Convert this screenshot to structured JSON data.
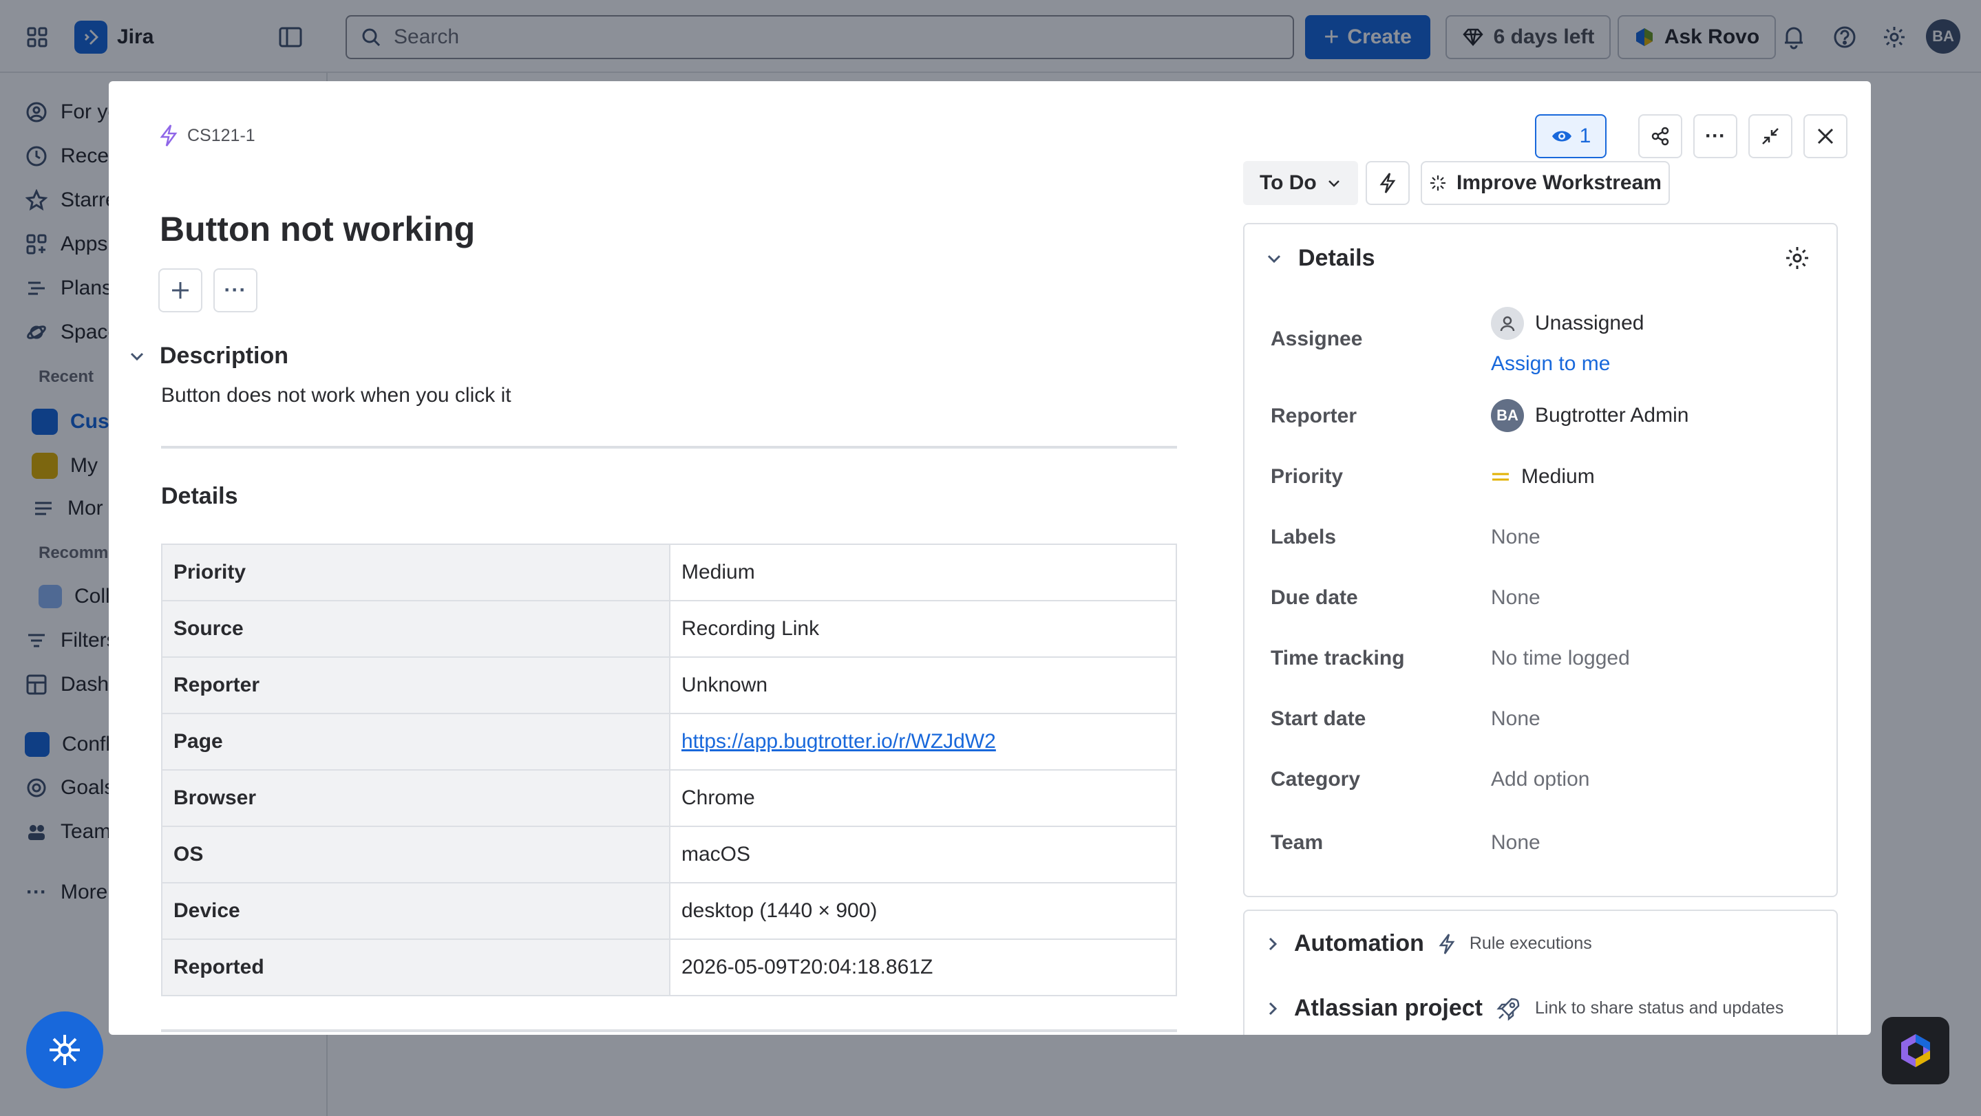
{
  "topbar": {
    "app_name": "Jira",
    "search_placeholder": "Search",
    "create_label": "Create",
    "trial_label": "6 days left",
    "ask_rovo_label": "Ask Rovo",
    "avatar_initials": "BA"
  },
  "sidebar": {
    "items": [
      {
        "label": "For yo",
        "icon": "person-circle-icon"
      },
      {
        "label": "Recen",
        "icon": "clock-icon"
      },
      {
        "label": "Starre",
        "icon": "star-icon"
      },
      {
        "label": "Apps",
        "icon": "apps-icon"
      },
      {
        "label": "Plans",
        "icon": "plans-icon"
      },
      {
        "label": "Space",
        "icon": "spaces-icon"
      }
    ],
    "recent_heading": "Recent",
    "recent_items": [
      {
        "label": "Cus"
      },
      {
        "label": "My"
      },
      {
        "label": "Mor"
      }
    ],
    "recommended_heading": "Recomm",
    "recommended_items": [
      {
        "label": "Coll"
      }
    ],
    "bottom_items": [
      {
        "label": "Filters"
      },
      {
        "label": "Dashl"
      },
      {
        "label": "Confl"
      },
      {
        "label": "Goals"
      },
      {
        "label": "Team"
      },
      {
        "label": "More"
      }
    ]
  },
  "issue": {
    "key": "CS121-1",
    "title": "Button not working",
    "description_heading": "Description",
    "description": "Button does not work when you click it",
    "details_heading": "Details",
    "details_rows": [
      {
        "key": "Priority",
        "value": "Medium"
      },
      {
        "key": "Source",
        "value": "Recording Link"
      },
      {
        "key": "Reporter",
        "value": "Unknown"
      },
      {
        "key": "Page",
        "value": "https://app.bugtrotter.io/r/WZJdW2"
      },
      {
        "key": "Browser",
        "value": "Chrome"
      },
      {
        "key": "OS",
        "value": "macOS"
      },
      {
        "key": "Device",
        "value": "desktop (1440 × 900)"
      },
      {
        "key": "Reported",
        "value": "2026-05-09T20:04:18.861Z"
      }
    ]
  },
  "header_actions": {
    "watch_count": "1"
  },
  "status": {
    "label": "To Do",
    "improve_label": "Improve Workstream"
  },
  "details_panel": {
    "title": "Details",
    "assignee_label": "Assignee",
    "assignee_value": "Unassigned",
    "assign_to_me": "Assign to me",
    "reporter_label": "Reporter",
    "reporter_initials": "BA",
    "reporter_value": "Bugtrotter Admin",
    "priority_label": "Priority",
    "priority_value": "Medium",
    "labels_label": "Labels",
    "labels_value": "None",
    "due_label": "Due date",
    "due_value": "None",
    "time_label": "Time tracking",
    "time_value": "No time logged",
    "start_label": "Start date",
    "start_value": "None",
    "category_label": "Category",
    "category_value": "Add option",
    "team_label": "Team",
    "team_value": "None"
  },
  "automation": {
    "title": "Automation",
    "sub": "Rule executions"
  },
  "atlassian_project": {
    "title": "Atlassian project",
    "sub": "Link to share status and updates"
  },
  "colors": {
    "brand": "#1868db",
    "priority_medium": "#e2b203"
  }
}
